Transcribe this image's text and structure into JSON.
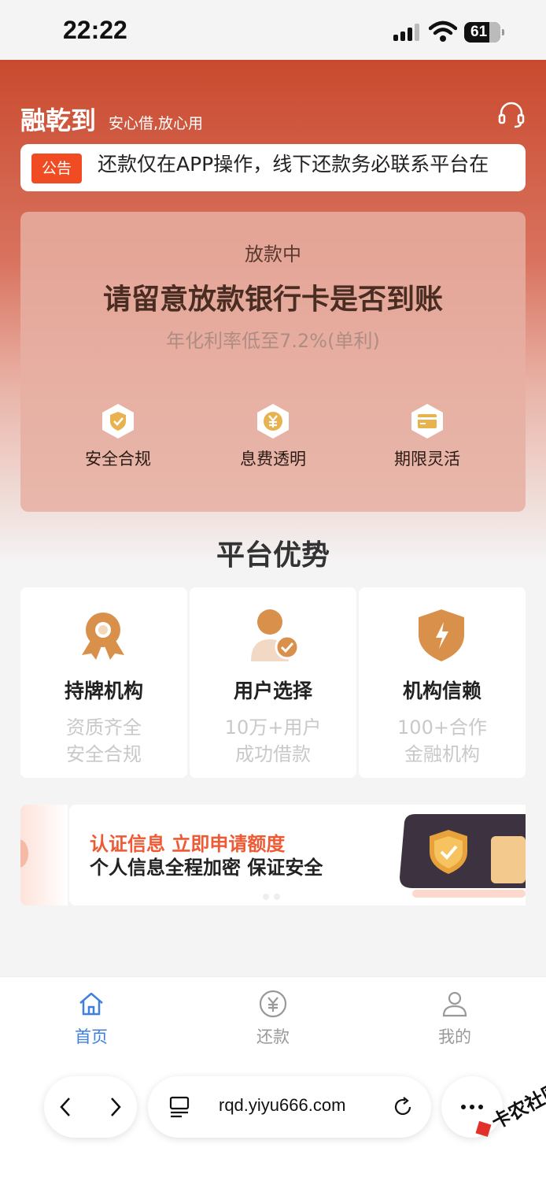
{
  "status_bar": {
    "time": "22:22",
    "battery": "61"
  },
  "header": {
    "brand": "融乾到",
    "slogan": "安心借,放心用"
  },
  "notice": {
    "tag": "公告",
    "text": "还款仅在APP操作，线下还款务必联系平台在"
  },
  "status_card": {
    "label": "放款中",
    "headline": "请留意放款银行卡是否到账",
    "rate": "年化利率低至7.2%(单利)",
    "features": [
      {
        "icon": "shield-check-icon",
        "label": "安全合规"
      },
      {
        "icon": "yen-icon",
        "label": "息费透明"
      },
      {
        "icon": "card-icon",
        "label": "期限灵活"
      }
    ]
  },
  "advantages": {
    "title": "平台优势",
    "items": [
      {
        "icon": "medal-icon",
        "title": "持牌机构",
        "line1": "资质齐全",
        "line2": "安全合规"
      },
      {
        "icon": "user-check-icon",
        "title": "用户选择",
        "line1": "10万+用户",
        "line2": "成功借款"
      },
      {
        "icon": "shield-bolt-icon",
        "title": "机构信赖",
        "line1": "100+合作",
        "line2": "金融机构"
      }
    ]
  },
  "banner": {
    "line1": "认证信息  立即申请额度",
    "line2": "个人信息全程加密 保证安全"
  },
  "tabs": [
    {
      "label": "首页",
      "icon": "home-icon",
      "active": true
    },
    {
      "label": "还款",
      "icon": "yen-circle-icon",
      "active": false
    },
    {
      "label": "我的",
      "icon": "user-icon",
      "active": false
    }
  ],
  "browser": {
    "url": "rqd.yiyu666.com"
  },
  "watermark": "卡农社区",
  "colors": {
    "accent": "#f04b22",
    "brand_red": "#c94a2e",
    "tab_active": "#3f7fe0",
    "icon_gold": "#d8904a"
  }
}
